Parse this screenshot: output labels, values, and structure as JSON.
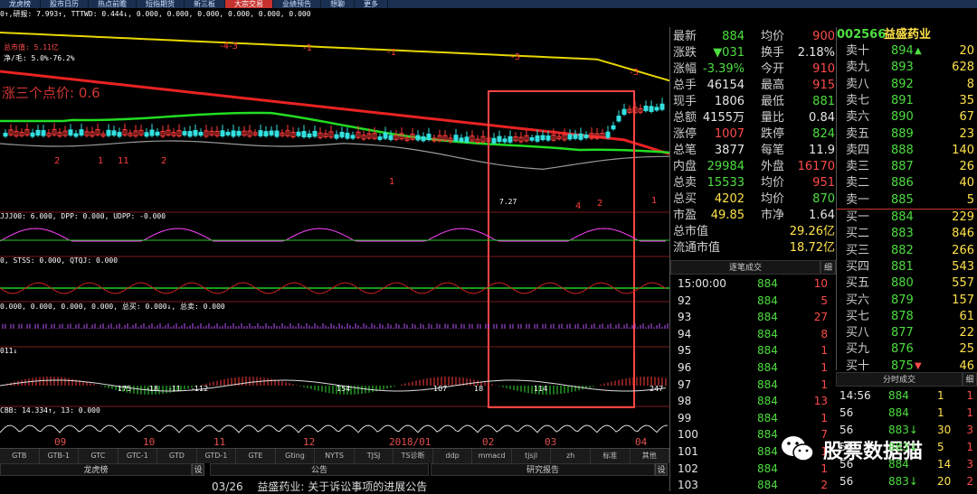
{
  "topbar": {
    "tabs": [
      "龙虎榜",
      "股市日历",
      "热点前瞻",
      "短指期货",
      "新三板",
      "大宗交易",
      "业绩预告",
      "想聊",
      "更多"
    ],
    "active_index": 5
  },
  "chart": {
    "indicator_line1": "0↑,研报: 7.993↑, TTTWD: 0.444↓, 0.000, 0.000, 0.000, 0.000, 0.000, 0.000",
    "note1": "总市值: 5.11亿",
    "note2": "净/毛: 5.0%-76.2%",
    "big_label": "涨三个点价: 0.6",
    "sub1": "JJJ00: 6.000, DPP: 0.000, UDPP: -0.000",
    "sub2": "0, STSS: 0.000, QTQJ: 0.000",
    "sub3": "0.000, 0.000, 0.000, 0.000, 总买: 0.000↓, 总卖: 0.000",
    "sub4": "011↓",
    "sub5": "CBB: 14.334↑, 13: 0.000",
    "low_label": "7.27",
    "top_marks": [
      "-4-3",
      "-1",
      "-1",
      "-3",
      "-3"
    ],
    "low_marks": [
      "2",
      "1",
      "11",
      "2",
      "1",
      "4",
      "2",
      "1"
    ],
    "macd_vals": [
      "175",
      "-18",
      "-11",
      "-112",
      "154",
      "107",
      "18",
      "114",
      "247"
    ],
    "x_axis": [
      "09",
      "10",
      "11",
      "12",
      "2018/01",
      "02",
      "03",
      "04"
    ]
  },
  "bottom_tabs": [
    "GTB",
    "GTB-1",
    "GTC",
    "GTC-1",
    "GTD",
    "GTD-1",
    "GTE",
    "Gting",
    "NYTS",
    "TJSJ",
    "TS诊断",
    "ddp",
    "mmacd",
    "tjsjl",
    "zh",
    "标准",
    "其他"
  ],
  "bottom_panel": {
    "sec1": "龙虎榜",
    "sec2": "公告",
    "sec3": "研究报告",
    "set_label": "设",
    "notice_date": "03/26",
    "notice_text": "益盛药业: 关于诉讼事项的进展公告"
  },
  "quote": {
    "rows": [
      {
        "l": "最新",
        "v": "884",
        "vc": "green",
        "l2": "均价",
        "v2": "900",
        "v2c": "red"
      },
      {
        "l": "涨跌",
        "v": "▼031",
        "vc": "green",
        "l2": "换手",
        "v2": "2.18%",
        "v2c": "white"
      },
      {
        "l": "涨幅",
        "v": "-3.39%",
        "vc": "green",
        "l2": "今开",
        "v2": "910",
        "v2c": "red"
      },
      {
        "l": "总手",
        "v": "46154",
        "vc": "white",
        "l2": "最高",
        "v2": "915",
        "v2c": "red"
      },
      {
        "l": "现手",
        "v": "1806",
        "vc": "white",
        "l2": "最低",
        "v2": "881",
        "v2c": "green"
      },
      {
        "l": "总额",
        "v": "4155万",
        "vc": "white",
        "l2": "量比",
        "v2": "0.84",
        "v2c": "white"
      },
      {
        "l": "涨停",
        "v": "1007",
        "vc": "red",
        "l2": "跌停",
        "v2": "824",
        "v2c": "green"
      },
      {
        "l": "总笔",
        "v": "3877",
        "vc": "white",
        "l2": "每笔",
        "v2": "11.9",
        "v2c": "white"
      },
      {
        "l": "内盘",
        "v": "29984",
        "vc": "green",
        "l2": "外盘",
        "v2": "16170",
        "v2c": "red"
      },
      {
        "l": "总卖",
        "v": "15533",
        "vc": "green",
        "l2": "均价",
        "v2": "951",
        "v2c": "red"
      },
      {
        "l": "总买",
        "v": "4202",
        "vc": "yellow",
        "l2": "均价",
        "v2": "870",
        "v2c": "green"
      },
      {
        "l": "市盈",
        "v": "49.85",
        "vc": "yellow",
        "l2": "市净",
        "v2": "1.64",
        "v2c": "white"
      }
    ],
    "mcap_label": "总市值",
    "mcap_value": "29.26亿",
    "float_label": "流通市值",
    "float_value": "18.72亿"
  },
  "stock": {
    "code": "002566",
    "name": "益盛药业"
  },
  "orderbook": {
    "sells": [
      {
        "label": "卖十",
        "price": "894",
        "vol": "20",
        "arrow": "▲"
      },
      {
        "label": "卖九",
        "price": "893",
        "vol": "628"
      },
      {
        "label": "卖八",
        "price": "892",
        "vol": "8"
      },
      {
        "label": "卖七",
        "price": "891",
        "vol": "35"
      },
      {
        "label": "卖六",
        "price": "890",
        "vol": "67"
      },
      {
        "label": "卖五",
        "price": "889",
        "vol": "23"
      },
      {
        "label": "卖四",
        "price": "888",
        "vol": "140"
      },
      {
        "label": "卖三",
        "price": "887",
        "vol": "26"
      },
      {
        "label": "卖二",
        "price": "886",
        "vol": "40"
      },
      {
        "label": "卖一",
        "price": "885",
        "vol": "5"
      }
    ],
    "buys": [
      {
        "label": "买一",
        "price": "884",
        "vol": "229"
      },
      {
        "label": "买二",
        "price": "883",
        "vol": "846"
      },
      {
        "label": "买三",
        "price": "882",
        "vol": "266"
      },
      {
        "label": "买四",
        "price": "881",
        "vol": "543"
      },
      {
        "label": "买五",
        "price": "880",
        "vol": "557"
      },
      {
        "label": "买六",
        "price": "879",
        "vol": "157"
      },
      {
        "label": "买七",
        "price": "878",
        "vol": "61"
      },
      {
        "label": "买八",
        "price": "877",
        "vol": "22"
      },
      {
        "label": "买九",
        "price": "876",
        "vol": "25"
      },
      {
        "label": "买十",
        "price": "875",
        "vol": "46",
        "arrow": "▼"
      }
    ]
  },
  "trades": {
    "title": "逐笔成交",
    "set_label": "细",
    "rows": [
      {
        "t": "15:00:00",
        "p": "884",
        "v": "10"
      },
      {
        "t": "92",
        "p": "884",
        "v": "5"
      },
      {
        "t": "93",
        "p": "884",
        "v": "27"
      },
      {
        "t": "94",
        "p": "884",
        "v": "8"
      },
      {
        "t": "95",
        "p": "884",
        "v": "1"
      },
      {
        "t": "96",
        "p": "884",
        "v": "1"
      },
      {
        "t": "97",
        "p": "884",
        "v": "1"
      },
      {
        "t": "98",
        "p": "884",
        "v": "13"
      },
      {
        "t": "99",
        "p": "884",
        "v": "1"
      },
      {
        "t": "100",
        "p": "884",
        "v": "7"
      },
      {
        "t": "101",
        "p": "884",
        "v": "1"
      },
      {
        "t": "102",
        "p": "884",
        "v": "1"
      },
      {
        "t": "103",
        "p": "884",
        "v": "2"
      }
    ]
  },
  "minute_trades": {
    "title": "分时成交",
    "set_label": "细",
    "rows": [
      {
        "t": "14:56",
        "p": "884",
        "v": "1",
        "n": "1"
      },
      {
        "t": "56",
        "p": "884",
        "v": "1",
        "n": "1"
      },
      {
        "t": "56",
        "p": "883↓",
        "v": "30",
        "n": "3"
      },
      {
        "t": "56",
        "p": "883↓",
        "v": "5",
        "n": "1"
      },
      {
        "t": "56",
        "p": "884",
        "v": "14",
        "n": "3"
      },
      {
        "t": "56",
        "p": "883↓",
        "v": "20",
        "n": "2"
      }
    ]
  },
  "watermark": {
    "text": "股票数据猫"
  },
  "colors": {
    "accent_red": "#c8322e",
    "up": "#ff4b4b",
    "down": "#4dde3f",
    "highlight_box": "#ff4444"
  }
}
